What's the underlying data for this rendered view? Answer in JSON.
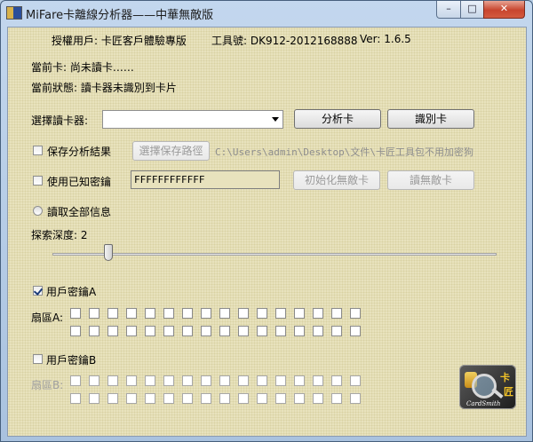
{
  "window": {
    "title": "MiFare卡離線分析器——中華無敵版",
    "controls": {
      "minimize": "–",
      "maximize": "□",
      "close": "✕"
    }
  },
  "header": {
    "authorized_user": "授權用戶: 卡匠客戶體驗專版",
    "tool_id": "工具號: DK912-2012168888",
    "version": "Ver: 1.6.5"
  },
  "status": {
    "current_card": "當前卡: 尚未讀卡……",
    "current_state": "當前狀態: 讀卡器未識別到卡片"
  },
  "reader": {
    "label": "選擇讀卡器:",
    "selected": "",
    "analyze_button": "分析卡",
    "identify_button": "識別卡"
  },
  "save": {
    "checkbox_label": "保存分析結果",
    "checked": false,
    "path_button": "選擇保存路徑",
    "path": "C:\\Users\\admin\\Desktop\\文件\\卡匠工具包不用加密狗"
  },
  "known_key": {
    "checkbox_label": "使用已知密鑰",
    "checked": false,
    "value": "FFFFFFFFFFFF",
    "init_button": "初始化無敵卡",
    "read_button": "讀無敵卡"
  },
  "read_all": {
    "label": "讀取全部信息"
  },
  "depth": {
    "label": "探索深度: 2",
    "value": 2
  },
  "key_a": {
    "checkbox_label": "用戶密鑰A",
    "checked": true,
    "sector_label": "扇區A:"
  },
  "key_b": {
    "checkbox_label": "用戶密鑰B",
    "checked": false,
    "sector_label": "扇區B:"
  },
  "logo": {
    "char1": "卡",
    "char2": "匠",
    "signature": "CardSmith"
  }
}
